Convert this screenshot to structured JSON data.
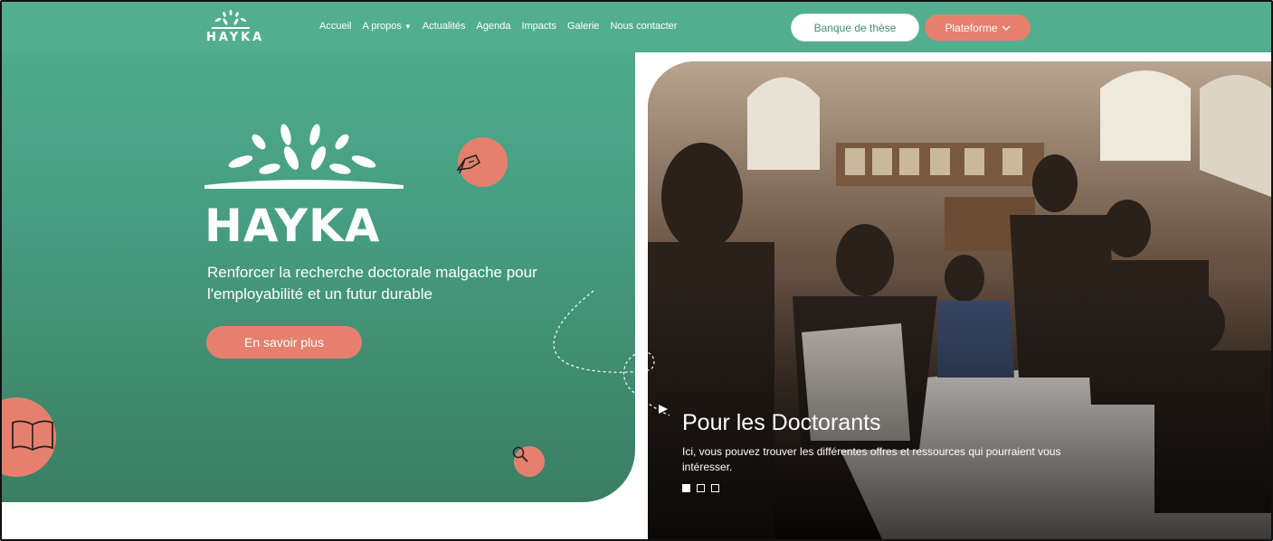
{
  "brand": {
    "name": "HAYKA",
    "small_label": "HAYKA"
  },
  "nav": {
    "items": [
      "Accueil",
      "A propos",
      "Actualités",
      "Agenda",
      "Impacts",
      "Galerie",
      "Nous contacter"
    ],
    "dropdown_index": 1
  },
  "header_buttons": {
    "banque": "Banque de thèse",
    "plateforme": "Plateforme"
  },
  "hero": {
    "title": "HAYKA",
    "tagline": "Renforcer la recherche doctorale malgache pour l'employabilité et un futur durable",
    "cta": "En savoir plus"
  },
  "slider": {
    "title": "Pour les Doctorants",
    "text": "Ici, vous pouvez trouver les différentes offres et ressources qui pourraient vous intéresser.",
    "total_slides": 3,
    "active_slide": 1
  },
  "colors": {
    "green": "#52ae8f",
    "coral": "#e6806e",
    "white": "#ffffff"
  },
  "icons": [
    "leaves-logo-icon",
    "caret-down-icon",
    "chevron-down-icon",
    "pen-hand-icon",
    "book-icon",
    "magnifier-icon"
  ]
}
